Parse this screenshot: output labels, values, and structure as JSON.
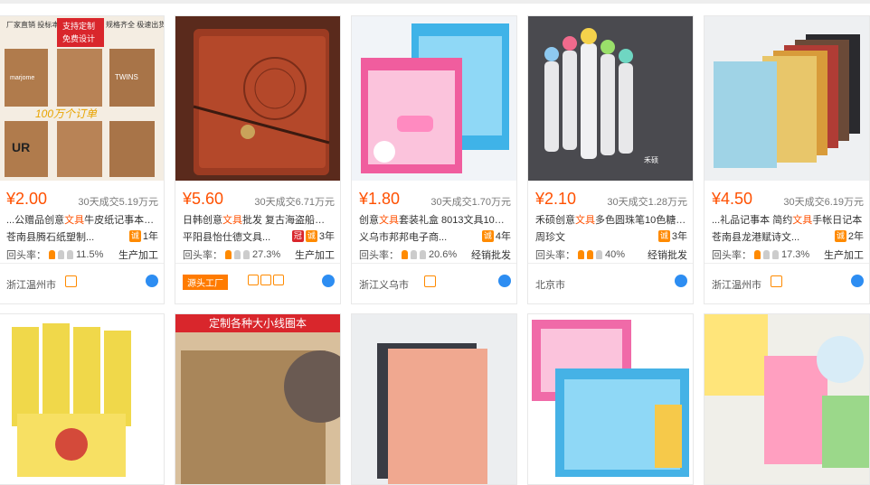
{
  "products": [
    {
      "price": "¥2.00",
      "deal": "30天成交5.19万元",
      "title_pre": "...公赠品创意",
      "title_hl": "文具",
      "title_post": "牛皮纸记事本定做",
      "shop": "苍南县腾石纸塑制...",
      "years": "1年",
      "rate": "11.5%",
      "biz": "生产加工",
      "loc": "浙江温州市"
    },
    {
      "price": "¥5.60",
      "deal": "30天成交6.71万元",
      "title_pre": "日韩创意",
      "title_hl": "文具",
      "title_post": "批发 复古海盗船笔记...",
      "shop": "平阳县怡仕德文具...",
      "years": "3年",
      "rate": "27.3%",
      "biz": "生产加工",
      "loc": "",
      "factory": "源头工厂"
    },
    {
      "price": "¥1.80",
      "deal": "30天成交1.70万元",
      "title_pre": "创意",
      "title_hl": "文具",
      "title_post": "套装礼盒 8013文具10件套...",
      "shop": "义乌市邦邦电子商...",
      "years": "4年",
      "rate": "20.6%",
      "biz": "经销批发",
      "loc": "浙江义乌市"
    },
    {
      "price": "¥2.10",
      "deal": "30天成交1.28万元",
      "title_pre": "禾硕创意",
      "title_hl": "文具",
      "title_post": "多色圆珠笔10色糖果...",
      "shop": "周珍文",
      "years": "3年",
      "rate": "40%",
      "biz": "经销批发",
      "loc": "北京市"
    },
    {
      "price": "¥4.50",
      "deal": "30天成交6.19万元",
      "title_pre": "...礼品记事本 简约",
      "title_hl": "文具",
      "title_post": "手帐日记本",
      "shop": "苍南县龙港赋诗文...",
      "years": "2年",
      "rate": "17.3%",
      "biz": "生产加工",
      "loc": "浙江温州市"
    }
  ],
  "labels": {
    "rate_label": "回头率：",
    "banner": "定制各种大小线圈本"
  }
}
